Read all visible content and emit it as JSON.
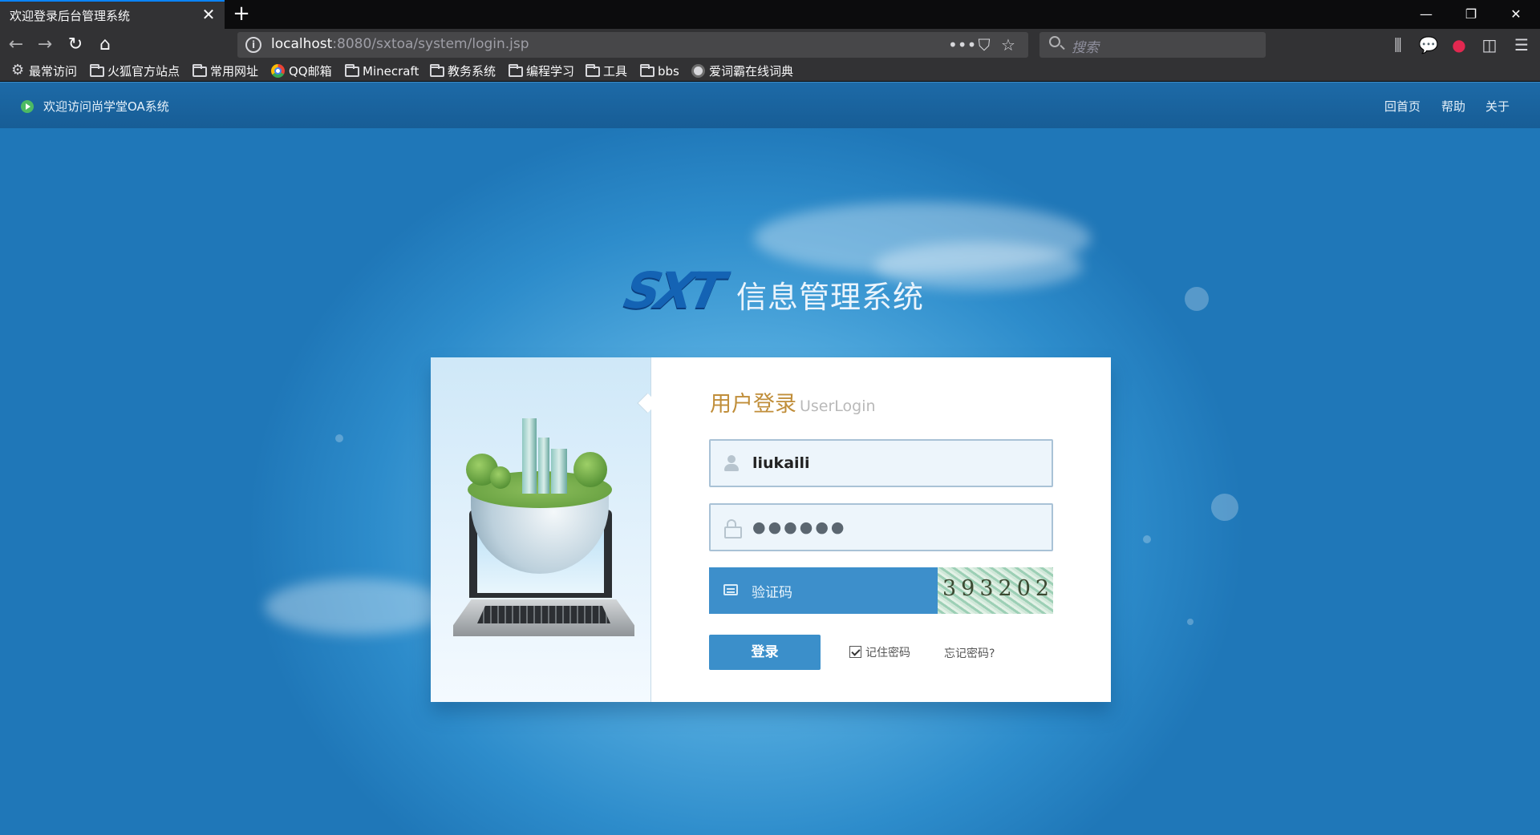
{
  "browser": {
    "tab_title": "欢迎登录后台管理系统",
    "url_host": "localhost",
    "url_rest": ":8080/sxtoa/system/login.jsp",
    "search_placeholder": "搜索",
    "bookmarks": [
      "最常访问",
      "火狐官方站点",
      "常用网址",
      "QQ邮箱",
      "Minecraft",
      "教务系统",
      "编程学习",
      "工具",
      "bbs",
      "爱词霸在线词典"
    ]
  },
  "page": {
    "welcome": "欢迎访问尚学堂OA系统",
    "links": [
      "回首页",
      "帮助",
      "关于"
    ],
    "logo_mark": "SXT",
    "logo_text": "信息管理系统",
    "login": {
      "title_cn": "用户登录",
      "title_en": "UserLogin",
      "username": "liukaili",
      "password_mask": "●●●●●●",
      "captcha_placeholder": "验证码",
      "captcha_code": "393202",
      "submit": "登录",
      "remember": "记住密码",
      "forgot": "忘记密码?"
    }
  },
  "colors": {
    "accent": "#3b8fca",
    "title_gold": "#c08e3a",
    "page_blue": "#2d8ccb"
  }
}
